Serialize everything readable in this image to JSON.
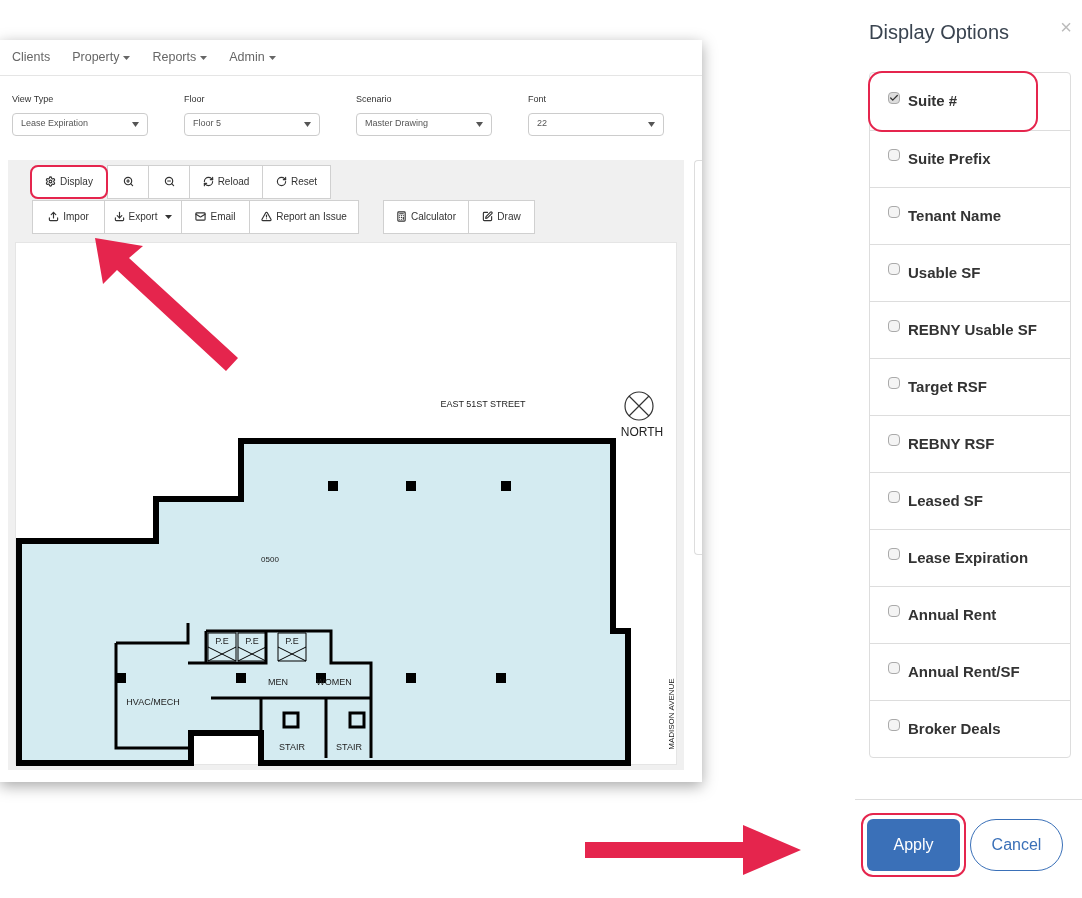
{
  "nav": [
    {
      "label": "Clients",
      "dropdown": false
    },
    {
      "label": "Property",
      "dropdown": true
    },
    {
      "label": "Reports",
      "dropdown": true
    },
    {
      "label": "Admin",
      "dropdown": true
    }
  ],
  "filters": [
    {
      "label": "View Type",
      "value": "Lease Expiration"
    },
    {
      "label": "Floor",
      "value": "Floor 5"
    },
    {
      "label": "Scenario",
      "value": "Master Drawing"
    },
    {
      "label": "Font",
      "value": "22"
    }
  ],
  "toolbar_row_1": [
    {
      "kind": "display",
      "label": "Display",
      "highlighted": true
    },
    {
      "kind": "zoom_in",
      "highlighted": false
    },
    {
      "kind": "zoom_out",
      "highlighted": false
    },
    {
      "kind": "reload",
      "label": "Reload",
      "highlighted": false
    },
    {
      "kind": "reset",
      "label": "Reset",
      "highlighted": false
    }
  ],
  "toolbar_row_2": [
    {
      "kind": "import",
      "label": "Impor",
      "dropdown": false
    },
    {
      "kind": "export",
      "label": "Export",
      "dropdown": true
    },
    {
      "kind": "email",
      "label": "Email",
      "dropdown": false
    },
    {
      "kind": "report",
      "label": "Report an Issue",
      "dropdown": false
    }
  ],
  "toolbar_row_3": [
    {
      "kind": "calculator",
      "label": "Calculator",
      "dropdown": false
    },
    {
      "kind": "draw",
      "label": "Draw",
      "dropdown": false
    }
  ],
  "floor_plan": {
    "street": "EAST 51ST STREET",
    "compass": "NORTH",
    "suite": "0500",
    "avenue": "MADISON AVENUE",
    "rooms": [
      {
        "kind": "pe",
        "label": "P.E"
      },
      {
        "kind": "pe",
        "label": "P.E"
      },
      {
        "kind": "pe",
        "label": "P.E"
      },
      {
        "kind": "men",
        "label": "MEN"
      },
      {
        "kind": "women",
        "label": "WOMEN"
      },
      {
        "kind": "hvac",
        "label": "HVAC/MECH"
      },
      {
        "kind": "stair_a",
        "label": "STAIR"
      },
      {
        "kind": "stair_b",
        "label": "STAIR"
      }
    ]
  },
  "display_options": {
    "title": "Display Options",
    "close": "×",
    "options": [
      {
        "label": "Suite #",
        "checked": true,
        "highlighted": true
      },
      {
        "label": "Suite Prefix",
        "checked": false,
        "highlighted": false
      },
      {
        "label": "Tenant Name",
        "checked": false,
        "highlighted": false
      },
      {
        "label": "Usable SF",
        "checked": false,
        "highlighted": false
      },
      {
        "label": "REBNY Usable SF",
        "checked": false,
        "highlighted": false
      },
      {
        "label": "Target RSF",
        "checked": false,
        "highlighted": false
      },
      {
        "label": "REBNY RSF",
        "checked": false,
        "highlighted": false
      },
      {
        "label": "Leased SF",
        "checked": false,
        "highlighted": false
      },
      {
        "label": "Lease Expiration",
        "checked": false,
        "highlighted": false
      },
      {
        "label": "Annual Rent",
        "checked": false,
        "highlighted": false
      },
      {
        "label": "Annual Rent/SF",
        "checked": false,
        "highlighted": false
      },
      {
        "label": "Broker Deals",
        "checked": false,
        "highlighted": false
      }
    ],
    "buttons": [
      {
        "kind": "primary",
        "label": "Apply",
        "highlighted": true
      },
      {
        "kind": "secondary",
        "label": "Cancel",
        "highlighted": false
      }
    ]
  }
}
